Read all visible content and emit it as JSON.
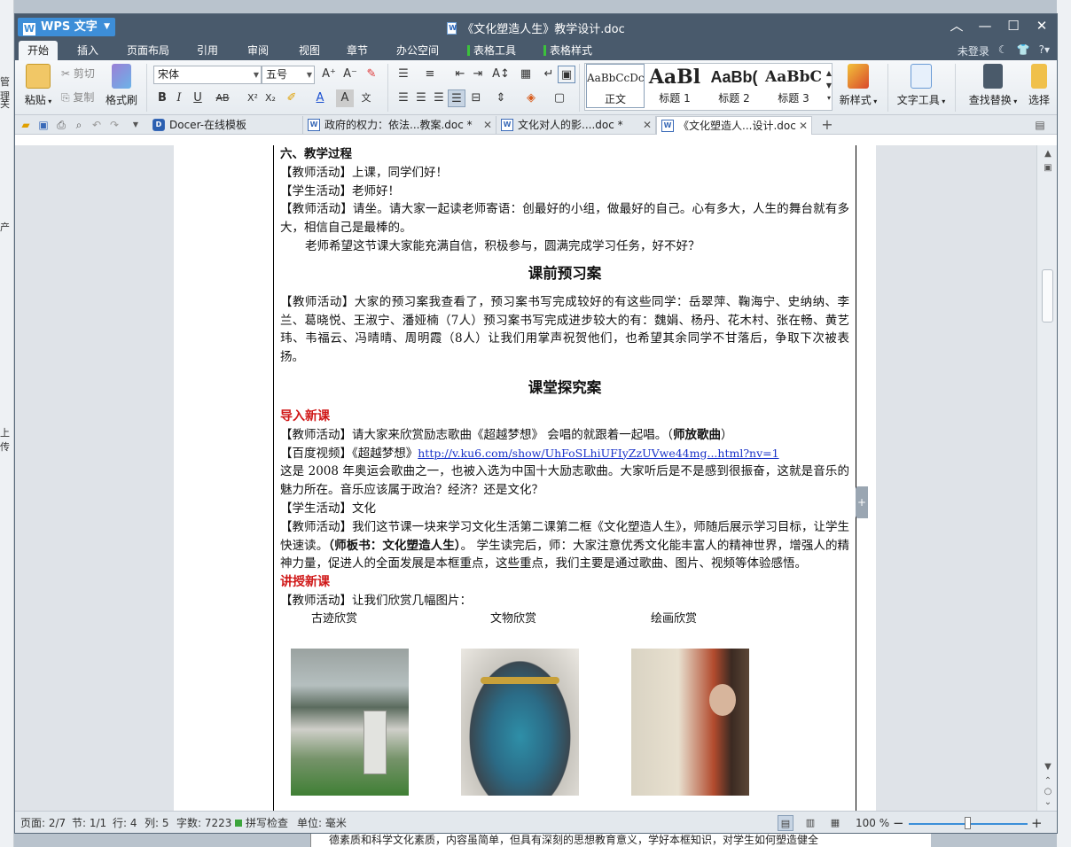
{
  "titlebar": {
    "app_name": "WPS 文字",
    "doc_title": "《文化塑造人生》教学设计.doc"
  },
  "menu": {
    "tabs": [
      "开始",
      "插入",
      "页面布局",
      "引用",
      "审阅",
      "视图",
      "章节",
      "办公空间",
      "表格工具",
      "表格样式"
    ],
    "login": "未登录",
    "help": "?"
  },
  "ribbon": {
    "paste": "粘贴",
    "cut": "剪切",
    "copy": "复制",
    "format_painter": "格式刷",
    "font_name": "宋体",
    "font_size": "五号",
    "styles": [
      {
        "sample": "AaBbCcDc",
        "label": "正文"
      },
      {
        "sample": "AaBl",
        "label": "标题 1"
      },
      {
        "sample": "AaBb(",
        "label": "标题 2"
      },
      {
        "sample": "AaBbC",
        "label": "标题 3"
      }
    ],
    "new_style": "新样式",
    "text_tools": "文字工具",
    "find_replace": "查找替换",
    "select": "选择"
  },
  "doctabs": [
    {
      "label": "Docer-在线模板"
    },
    {
      "label": "政府的权力：依法...教案.doc *"
    },
    {
      "label": "文化对人的影....doc *"
    },
    {
      "label": "《文化塑造人...设计.doc"
    }
  ],
  "document": {
    "section_heading": "六、教学过程",
    "p1": "【教师活动】上课，同学们好！",
    "p2": "【学生活动】老师好！",
    "p3": "【教师活动】请坐。请大家一起读老师寄语：创最好的小组，做最好的自己。心有多大，人生的舞台就有多大，相信自己是最棒的。",
    "p4": "老师希望这节课大家能充满自信，积极参与，圆满完成学习任务，好不好？",
    "title_preview": "课前预习案",
    "p5": "【教师活动】大家的预习案我查看了，预习案书写完成较好的有这些同学：岳翠萍、鞠海宁、史纳纳、李兰、葛晓悦、王淑宁、潘娅楠（7人）预习案书写完成进步较大的有：魏娟、杨丹、花木村、张在畅、黄艺玮、韦福云、冯晴晴、周明霞（8人）让我们用掌声祝贺他们，也希望其余同学不甘落后，争取下次被表扬。",
    "title_explore": "课堂探究案",
    "red1": "导入新课",
    "p6_a": "【教师活动】请大家来欣赏励志歌曲《超越梦想》 会唱的就跟着一起唱。（",
    "p6_b": "师放歌曲",
    "p6_c": "）",
    "p7_a": "【百度视频】《超越梦想》",
    "p7_link": "http://v.ku6.com/show/UhFoSLhiUFIyZzUVwe44mg...html?nv=1",
    "p8": "这是 2008 年奥运会歌曲之一，也被入选为中国十大励志歌曲。大家听后是不是感到很振奋，这就是音乐的魅力所在。音乐应该属于政治？经济？还是文化？",
    "p9": "【学生活动】文化",
    "p10_a": "【教师活动】我们这节课一块来学习文化生活第二课第二框《文化塑造人生》，师随后展示学习目标，让学生快速读。",
    "p10_b": "（师板书：文化塑造人生）",
    "p10_c": "。 学生读完后，师：大家注意优秀文化能丰富人的精神世界，增强人的精神力量，促进人的全面发展是本框重点，这些重点，我们主要是通过歌曲、图片、视频等体验感悟。",
    "red2": "讲授新课",
    "p11": "【教师活动】让我们欣赏几幅图片：",
    "captions": [
      "古迹欣赏",
      "文物欣赏",
      "绘画欣赏"
    ]
  },
  "status": {
    "page": "页面: 2/7",
    "section": "节: 1/1",
    "row": "行: 4",
    "col": "列: 5",
    "wordcount": "字数: 7223",
    "spellcheck": "拼写检查",
    "unit": "单位: 毫米",
    "zoom": "100 %"
  },
  "background": {
    "left_labels": [
      "管理",
      "关",
      "产",
      "上传"
    ],
    "bottom_text": "德素质和科学文化素质，内容虽简单，但具有深刻的思想教育意义，学好本框知识，对学生如何塑造健全"
  }
}
